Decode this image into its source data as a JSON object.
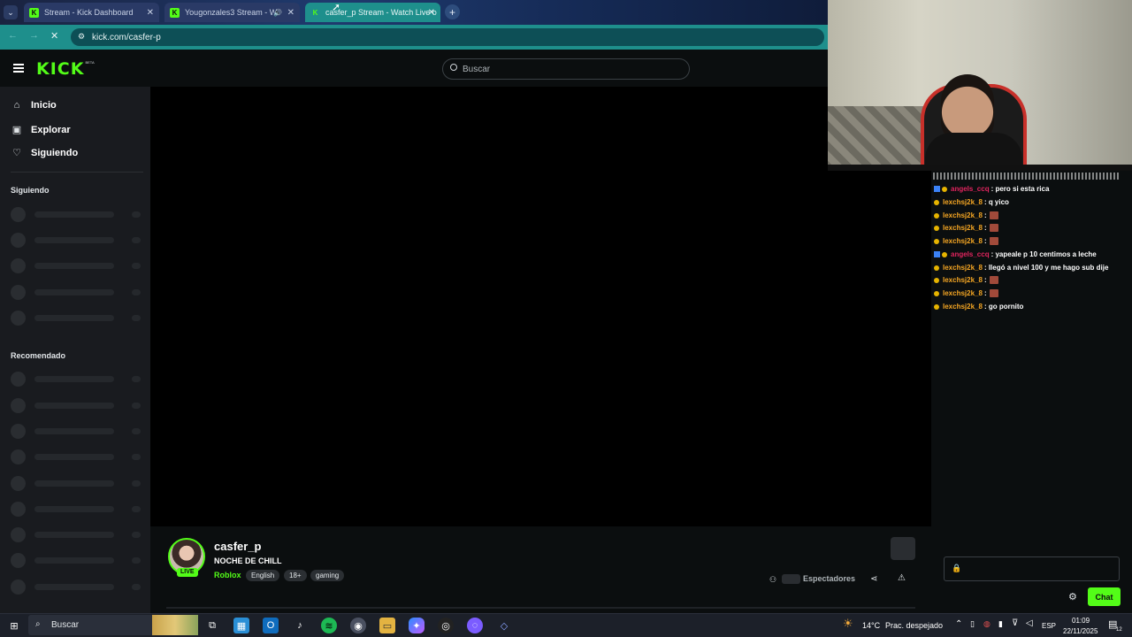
{
  "browser": {
    "tabs": [
      {
        "title": "Stream - Kick Dashboard",
        "active": false
      },
      {
        "title": "Yougonzales3 Stream - W",
        "active": false
      },
      {
        "title": "casfer_p Stream - Watch Live o",
        "active": true
      }
    ],
    "new_tab_icon": "plus-icon",
    "url": "kick.com/casfer-p"
  },
  "kick": {
    "logo": "KICK",
    "logo_badge": "BETA",
    "search_placeholder": "Buscar",
    "nav": [
      {
        "label": "Inicio",
        "icon": "home-icon"
      },
      {
        "label": "Explorar",
        "icon": "compass-icon"
      },
      {
        "label": "Siguiendo",
        "icon": "heart-icon"
      }
    ],
    "sections": {
      "following": "Siguiendo",
      "recommended": "Recomendado"
    }
  },
  "stream": {
    "username": "casfer_p",
    "title": "NOCHE DE CHILL",
    "live_badge": "LIVE",
    "category": "Roblox",
    "tags": [
      "English",
      "18+",
      "gaming"
    ],
    "viewers_label": "Espectadores"
  },
  "chat": {
    "messages": [
      {
        "user": "angels_ccq",
        "text": ": pero si esta rica",
        "user_color": "#e0245e",
        "badge": "box"
      },
      {
        "user": "lexchsj2k_8",
        "text": ": q yico",
        "user_color": "#f5a623",
        "badge": "dot"
      },
      {
        "user": "lexchsj2k_8",
        "text": ":",
        "user_color": "#f5a623",
        "badge": "dot",
        "emote": true
      },
      {
        "user": "lexchsj2k_8",
        "text": ":",
        "user_color": "#f5a623",
        "badge": "dot",
        "emote": true
      },
      {
        "user": "lexchsj2k_8",
        "text": ":",
        "user_color": "#f5a623",
        "badge": "dot",
        "emote": true
      },
      {
        "user": "angels_ccq",
        "text": ": yapeale p 10 centimos a leche",
        "user_color": "#e0245e",
        "badge": "box"
      },
      {
        "user": "lexchsj2k_8",
        "text": ": llegó a nivel 100 y me hago sub dije",
        "user_color": "#f5a623",
        "badge": "dot"
      },
      {
        "user": "lexchsj2k_8",
        "text": ":",
        "user_color": "#f5a623",
        "badge": "dot",
        "emote": true
      },
      {
        "user": "lexchsj2k_8",
        "text": ":",
        "user_color": "#f5a623",
        "badge": "dot",
        "emote": true
      },
      {
        "user": "lexchsj2k_8",
        "text": ": go pornito",
        "user_color": "#f5a623",
        "badge": "dot"
      }
    ],
    "send_button": "Chat"
  },
  "taskbar": {
    "search_placeholder": "Buscar",
    "weather": "14°C",
    "weather_desc": "Prac. despejado",
    "language": "ESP",
    "time": "01:09",
    "date": "22/11/2025",
    "notification_count": "12"
  },
  "colors": {
    "kick_green": "#53fc18",
    "address_bar": "#1e8f8c"
  }
}
